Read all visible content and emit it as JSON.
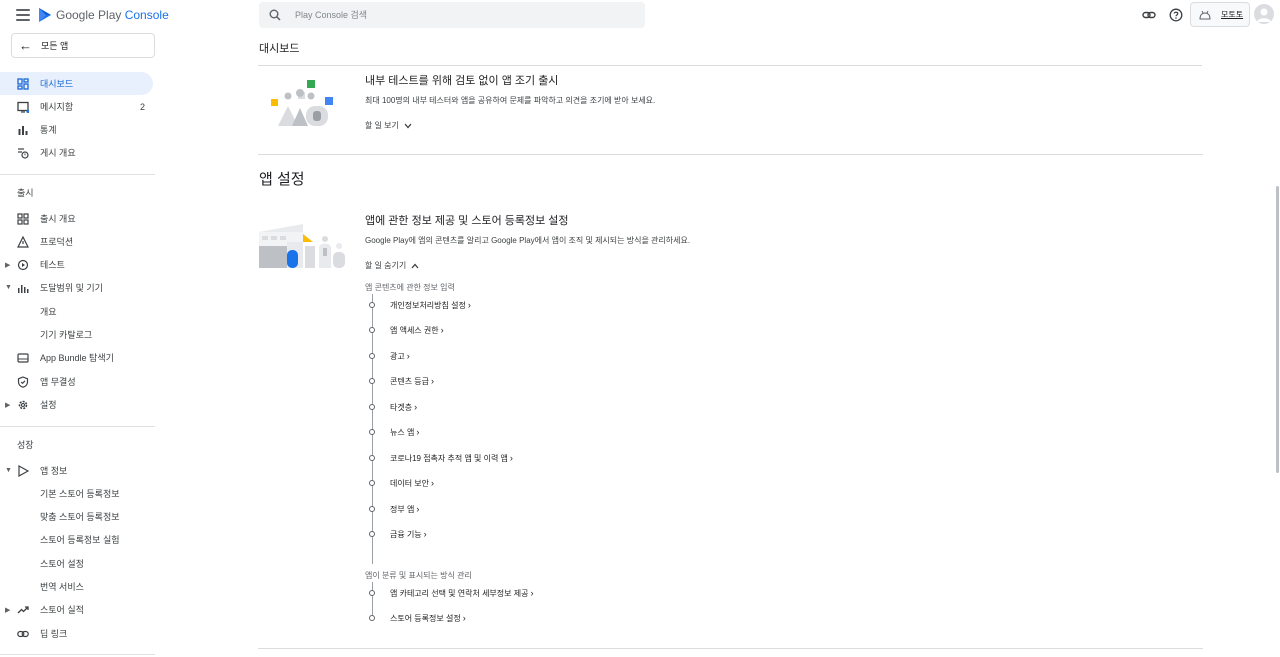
{
  "header": {
    "product_name_1": "Google Play",
    "product_name_2": "Console",
    "search_placeholder": "Play Console 검색",
    "app_name": "모토토"
  },
  "sidebar": {
    "all_apps_label": "모든 앱",
    "main_items": [
      {
        "label": "대시보드",
        "icon": "dashboard-icon",
        "active": true
      },
      {
        "label": "메시지함",
        "icon": "inbox-icon",
        "badge": "2"
      },
      {
        "label": "통계",
        "icon": "bar-chart-icon"
      },
      {
        "label": "게시 개요",
        "icon": "publishing-overview-icon"
      }
    ],
    "release_section_title": "출시",
    "release_items": [
      {
        "label": "출시 개요",
        "icon": "release-overview-icon"
      },
      {
        "label": "프로덕션",
        "icon": "production-icon"
      },
      {
        "label": "테스트",
        "icon": "testing-icon",
        "expandable": true
      },
      {
        "label": "도달범위 및 기기",
        "icon": "reach-devices-icon",
        "expandable": true,
        "expanded": true
      },
      {
        "label": "개요",
        "sub": true
      },
      {
        "label": "기기 카탈로그",
        "sub": true
      },
      {
        "label": "App Bundle 탐색기",
        "icon": "app-bundle-icon"
      },
      {
        "label": "앱 무결성",
        "icon": "shield-icon"
      },
      {
        "label": "설정",
        "icon": "gear-icon",
        "expandable": true
      }
    ],
    "grow_section_title": "성장",
    "grow_items": [
      {
        "label": "앱 정보",
        "icon": "store-presence-icon",
        "expandable": true,
        "expanded": true
      },
      {
        "label": "기본 스토어 등록정보",
        "sub": true
      },
      {
        "label": "맞춤 스토어 등록정보",
        "sub": true
      },
      {
        "label": "스토어 등록정보 실험",
        "sub": true
      },
      {
        "label": "스토어 설정",
        "sub": true
      },
      {
        "label": "번역 서비스",
        "sub": true
      },
      {
        "label": "스토어 실적",
        "icon": "trending-icon",
        "expandable": true
      },
      {
        "label": "딥 링크",
        "icon": "link-icon"
      }
    ]
  },
  "main": {
    "page_title": "대시보드",
    "internal_test_card": {
      "title": "내부 테스트를 위해 검토 없이 앱 조기 출시",
      "description": "최대 100명의 내부 테스터와 앱을 공유하여 문제를 파악하고 의견을 조기에 받아 보세요.",
      "toggle_label": "할 일 보기"
    },
    "section_title": "앱 설정",
    "app_setup_card": {
      "title": "앱에 관한 정보 제공 및 스토어 등록정보 설정",
      "description": "Google Play에 앱의 콘텐츠를 알리고 Google Play에서 앱이 조직 및 제시되는 방식을 관리하세요.",
      "toggle_label": "할 일 숨기기",
      "group1_label": "앱 콘텐츠에 관한 정보 입력",
      "group1_tasks": [
        "개인정보처리방침 설정",
        "앱 액세스 권한",
        "광고",
        "콘텐츠 등급",
        "타겟층",
        "뉴스 앱",
        "코로나19 접촉자 추적 앱 및 이력 앱",
        "데이터 보안",
        "정부 앱",
        "금융 기능"
      ],
      "group2_label": "앱이 분류 및 표시되는 방식 관리",
      "group2_tasks": [
        "앱 카테고리 선택 및 연락처 세부정보 제공",
        "스토어 등록정보 설정"
      ]
    }
  },
  "colors": {
    "accent": "#1a73e8",
    "active_bg": "#e8f0fe",
    "active_text": "#1967d2"
  }
}
